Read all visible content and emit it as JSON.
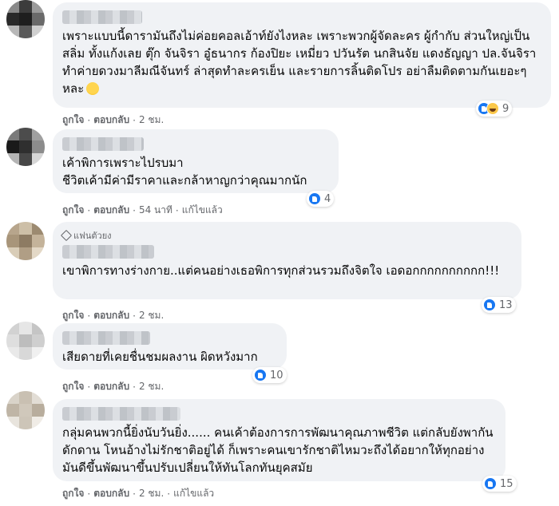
{
  "actions": {
    "like_label": "ถูกใจ",
    "reply_label": "ตอบกลับ",
    "edited_label": "แก้ไขแล้ว",
    "separator": "·"
  },
  "comments": [
    {
      "fan_badge": "",
      "text": "เพราะแบบนี้ดารามันถึงไม่ค่อยคอลเอ้าท์ยังไงหละ เพราะพวกผู้จัดละคร ผู้กำกับ ส่วนใหญ่เป็นสลิ่ม ทั้งแก้งเลย ตุ๊ก จันจิรา อู๋ธนากร ก้องปิยะ เหมี่ยว ปวันรัต นกสินจัย แดงธัญญา ปล.จันจิรา ทำค่ายดวงมาลีมณีจันทร์ ล่าสุดทำละครเย็น และรายการลิ้นติดโปร อย่าลืมติดตามกันเยอะๆหละ",
      "reaction_count": "9",
      "time": "2 ชม.",
      "edited": false
    },
    {
      "fan_badge": "",
      "text": "เค้าพิการเพราะไปรบมา\nชีวิตเค้ามีค่ามีราคาและกล้าหาญกว่าคุณมากนัก",
      "reaction_count": "4",
      "time": "54 นาที",
      "edited": true
    },
    {
      "fan_badge": "แฟนตัวยง",
      "text": "เขาพิการทางร่างกาย..แต่คนอย่างเธอพิการทุกส่วนรวมถึงจิตใจ เอดอกกกกกกกกกก!!!",
      "reaction_count": "13",
      "time": "2 ชม.",
      "edited": false
    },
    {
      "fan_badge": "",
      "text": "เสียดายที่เคยชื่นชมผลงาน ผิดหวังมาก",
      "reaction_count": "10",
      "time": "2 ชม.",
      "edited": false
    },
    {
      "fan_badge": "",
      "text": "กลุ่มคนพวกนี้ยิ่งนับวันยิ่ง...... คนเค้าต้องการการพัฒนาคุณภาพชีวิต แต่กลับยังพากันดักดาน โหนอ้างไม่รักชาติอยู่ได้ ก็เพราะคนเขารักชาติไหมวะถึงได้อยากให้ทุกอย่างมันดีขึ้นพัฒนาขึ้นปรับเปลี่ยนให้ทันโลกทันยุคสมัย",
      "reaction_count": "15",
      "time": "2 ชม.",
      "edited": true
    }
  ]
}
